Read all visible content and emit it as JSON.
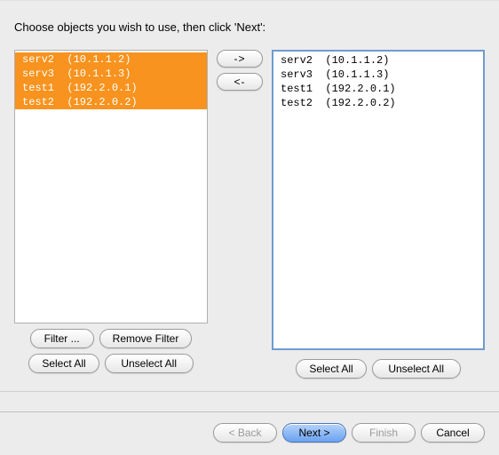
{
  "instruction": "Choose objects you wish to use, then click 'Next':",
  "left_list": {
    "items": [
      {
        "label": "serv2  (10.1.1.2)",
        "selected": true
      },
      {
        "label": "serv3  (10.1.1.3)",
        "selected": true
      },
      {
        "label": "test1  (192.2.0.1)",
        "selected": true
      },
      {
        "label": "test2  (192.2.0.2)",
        "selected": true
      }
    ]
  },
  "right_list": {
    "items": [
      {
        "label": "serv2  (10.1.1.2)",
        "selected": false
      },
      {
        "label": "serv3  (10.1.1.3)",
        "selected": false
      },
      {
        "label": "test1  (192.2.0.1)",
        "selected": false
      },
      {
        "label": "test2  (192.2.0.2)",
        "selected": false
      }
    ]
  },
  "buttons": {
    "filter": "Filter ...",
    "remove_filter": "Remove Filter",
    "select_all_left": "Select All",
    "unselect_all_left": "Unselect All",
    "select_all_right": "Select All",
    "unselect_all_right": "Unselect All",
    "move_right": "->",
    "move_left": "<-"
  },
  "footer": {
    "back": "< Back",
    "next": "Next >",
    "finish": "Finish",
    "cancel": "Cancel"
  }
}
